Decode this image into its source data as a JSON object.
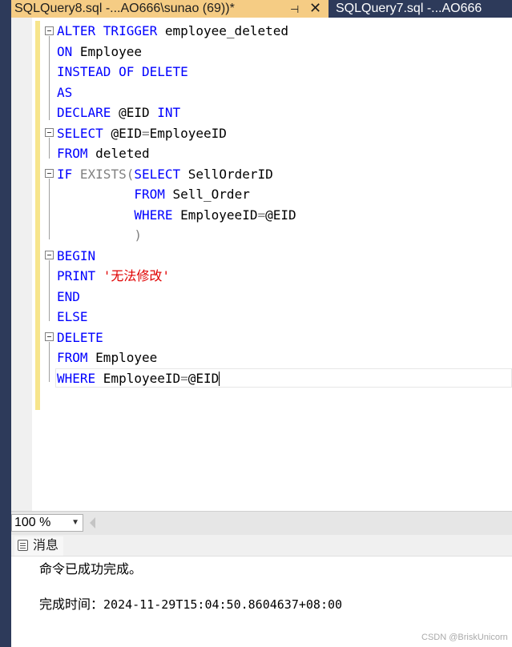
{
  "tabs": [
    {
      "title": "SQLQuery8.sql -...AO666\\sunao (69))*",
      "active": true
    },
    {
      "title": "SQLQuery7.sql -...AO666",
      "active": false
    }
  ],
  "tab_controls": {
    "pin": "⊣",
    "close": "✕"
  },
  "editor": {
    "lines": [
      {
        "tokens": [
          {
            "t": "ALTER TRIGGER ",
            "c": "kw"
          },
          {
            "t": "employee_deleted",
            "c": ""
          }
        ]
      },
      {
        "tokens": [
          {
            "t": "ON ",
            "c": "kw"
          },
          {
            "t": "Employee",
            "c": ""
          }
        ]
      },
      {
        "tokens": [
          {
            "t": "INSTEAD OF DELETE",
            "c": "kw"
          }
        ]
      },
      {
        "tokens": [
          {
            "t": "AS",
            "c": "kw"
          }
        ]
      },
      {
        "tokens": [
          {
            "t": "DECLARE ",
            "c": "kw"
          },
          {
            "t": "@EID ",
            "c": ""
          },
          {
            "t": "INT",
            "c": "kw"
          }
        ]
      },
      {
        "tokens": [
          {
            "t": "SELECT ",
            "c": "kw"
          },
          {
            "t": "@EID",
            "c": ""
          },
          {
            "t": "=",
            "c": "gr"
          },
          {
            "t": "EmployeeID",
            "c": ""
          }
        ]
      },
      {
        "tokens": [
          {
            "t": "FROM ",
            "c": "kw"
          },
          {
            "t": "deleted",
            "c": ""
          }
        ]
      },
      {
        "tokens": [
          {
            "t": "IF ",
            "c": "kw"
          },
          {
            "t": "EXISTS(",
            "c": "gr"
          },
          {
            "t": "SELECT ",
            "c": "kw"
          },
          {
            "t": "SellOrderID",
            "c": ""
          }
        ]
      },
      {
        "tokens": [
          {
            "t": "          ",
            "c": ""
          },
          {
            "t": "FROM ",
            "c": "kw"
          },
          {
            "t": "Sell_Order",
            "c": ""
          }
        ]
      },
      {
        "tokens": [
          {
            "t": "          ",
            "c": ""
          },
          {
            "t": "WHERE ",
            "c": "kw"
          },
          {
            "t": "EmployeeID",
            "c": ""
          },
          {
            "t": "=",
            "c": "gr"
          },
          {
            "t": "@EID",
            "c": ""
          }
        ]
      },
      {
        "tokens": [
          {
            "t": "          ",
            "c": ""
          },
          {
            "t": ")",
            "c": "gr"
          }
        ]
      },
      {
        "tokens": [
          {
            "t": "BEGIN",
            "c": "kw"
          }
        ]
      },
      {
        "tokens": [
          {
            "t": "PRINT ",
            "c": "kw"
          },
          {
            "t": "'无法修改'",
            "c": "str"
          }
        ]
      },
      {
        "tokens": [
          {
            "t": "END",
            "c": "kw"
          }
        ]
      },
      {
        "tokens": [
          {
            "t": "ELSE",
            "c": "kw"
          }
        ]
      },
      {
        "tokens": [
          {
            "t": "DELETE",
            "c": "kw"
          }
        ]
      },
      {
        "tokens": [
          {
            "t": "FROM ",
            "c": "kw"
          },
          {
            "t": "Employee",
            "c": ""
          }
        ]
      },
      {
        "tokens": [
          {
            "t": "WHERE ",
            "c": "kw"
          },
          {
            "t": "EmployeeID",
            "c": ""
          },
          {
            "t": "=",
            "c": "gr"
          },
          {
            "t": "@EID",
            "c": ""
          }
        ]
      }
    ]
  },
  "zoom": {
    "value": "100 %"
  },
  "results": {
    "tab_label": "消息",
    "message": "命令已成功完成。",
    "completion_label": "完成时间：",
    "completion_time": "2024-11-29T15:04:50.8604637+08:00"
  },
  "watermark": "CSDN @BriskUnicorn",
  "colors": {
    "keyword": "#0000ff",
    "operator": "#808080",
    "string": "#e00000",
    "active_tab": "#f5cc84",
    "frame": "#2d3a5a",
    "change_bar": "#f7e58c"
  }
}
